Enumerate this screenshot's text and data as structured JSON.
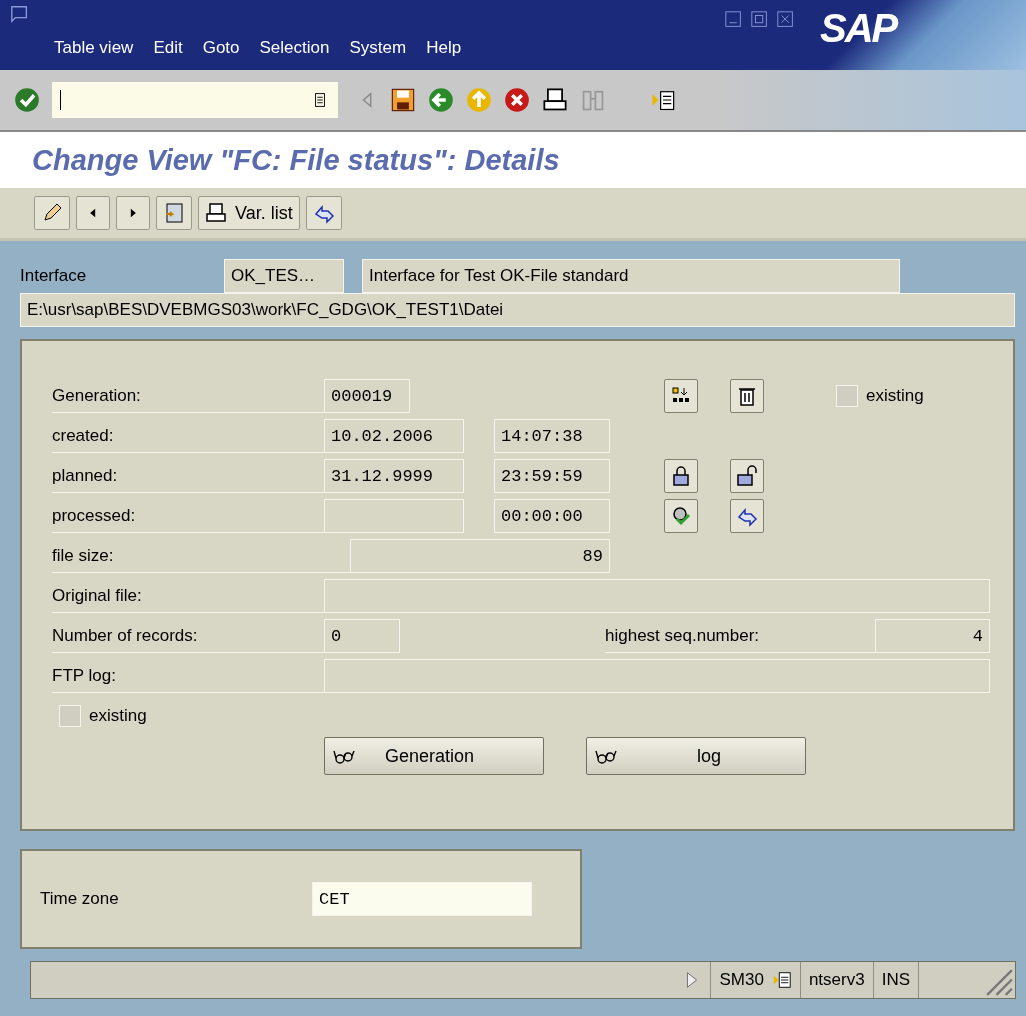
{
  "window": {
    "logo": "SAP",
    "menu": [
      "Table view",
      "Edit",
      "Goto",
      "Selection",
      "System",
      "Help"
    ]
  },
  "title": "Change View \"FC: File status\": Details",
  "app_toolbar": {
    "var_list_button": "Var. list"
  },
  "header": {
    "interface_label": "Interface",
    "interface_value": "OK_TES…",
    "interface_description": "Interface for Test OK-File standard",
    "path": "E:\\usr\\sap\\BES\\DVEBMGS03\\work\\FC_GDG\\OK_TEST1\\Datei"
  },
  "status": {
    "generation": {
      "label": "Generation:",
      "value": "000019"
    },
    "existing_top": {
      "label": "existing",
      "checked": false
    },
    "created": {
      "label": "created:",
      "date": "10.02.2006",
      "time": "14:07:38"
    },
    "planned": {
      "label": "planned:",
      "date": "31.12.9999",
      "time": "23:59:59"
    },
    "processed": {
      "label": "processed:",
      "time": "00:00:00"
    },
    "file_size": {
      "label": "file size:",
      "value": "89"
    },
    "original_file": {
      "label": "Original file:"
    },
    "records": {
      "label": "Number of records:",
      "value": "0"
    },
    "highest_seq": {
      "label": "highest seq.number:",
      "value": "4"
    },
    "ftp_log": {
      "label": "FTP log:"
    },
    "existing_bottom": {
      "label": "existing",
      "checked": false
    },
    "buttons": [
      "Generation",
      "log"
    ]
  },
  "time_zone": {
    "label": "Time zone",
    "value": "CET"
  },
  "status_bar": {
    "transaction": "SM30",
    "server": "ntserv3",
    "mode": "INS"
  }
}
